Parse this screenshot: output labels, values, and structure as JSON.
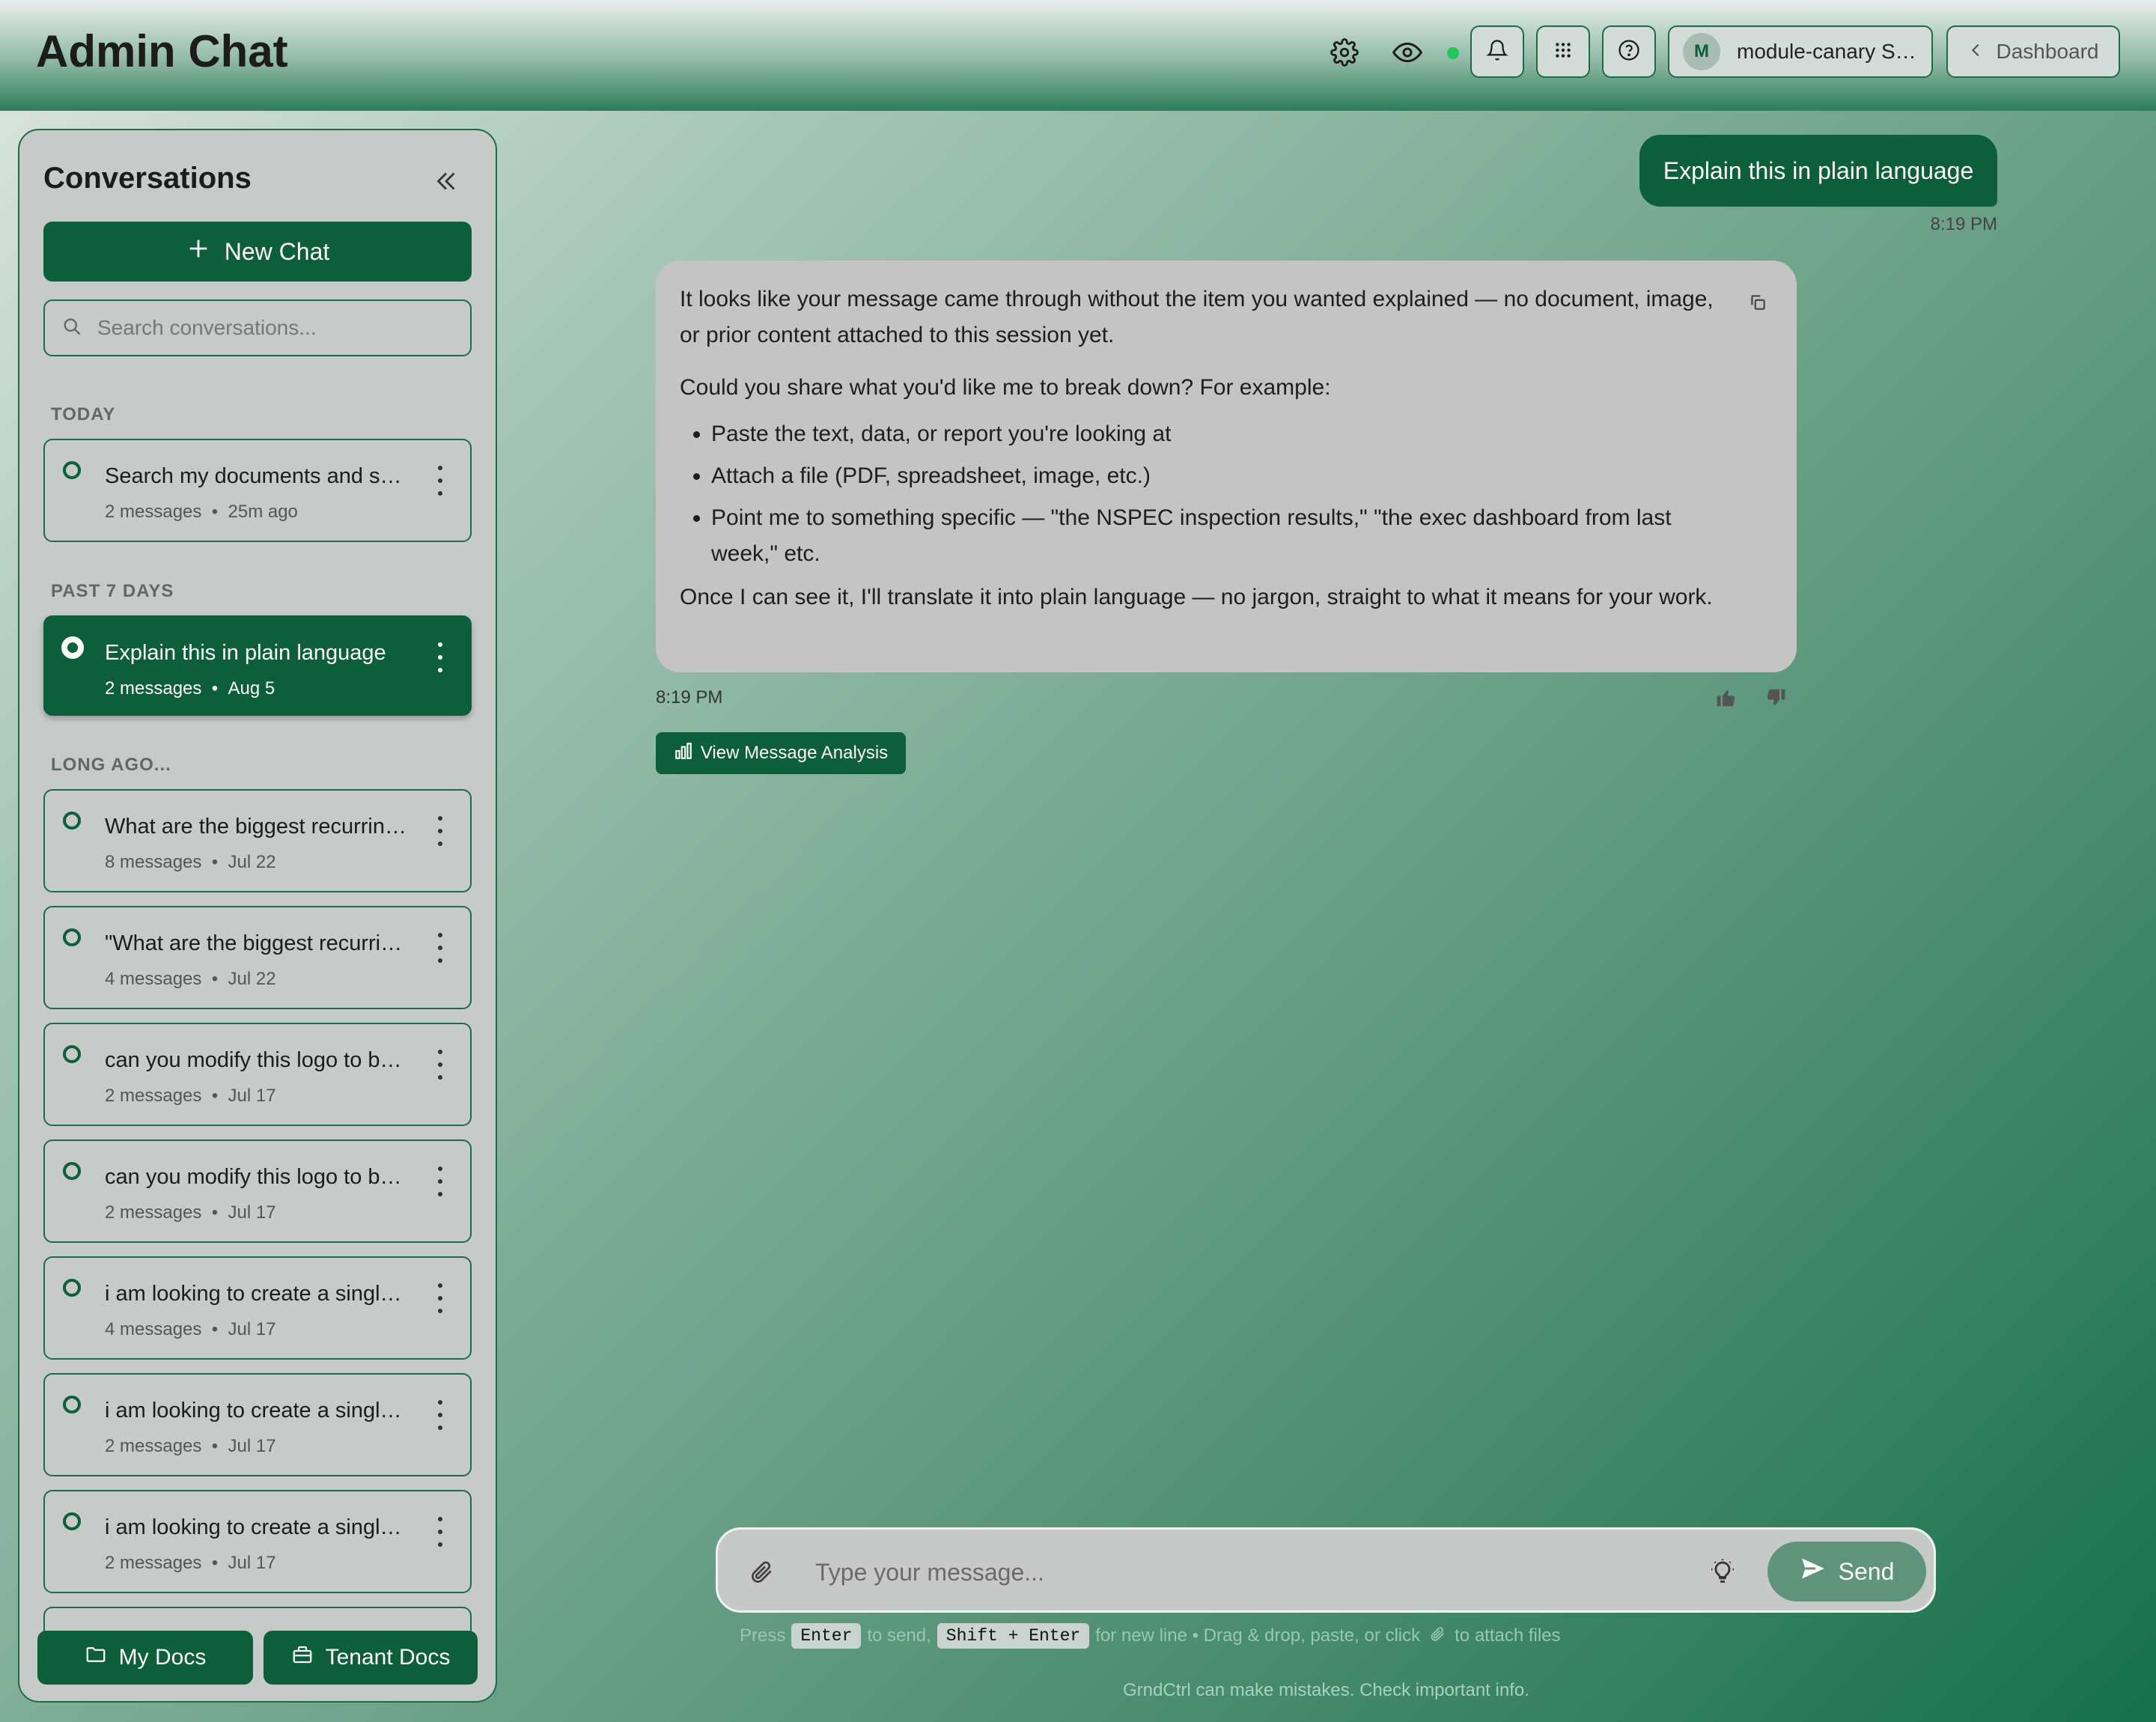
{
  "header": {
    "title": "Admin Chat",
    "user_initial": "M",
    "user_name": "module-canary S…",
    "dashboard_label": "Dashboard"
  },
  "sidebar": {
    "title": "Conversations",
    "new_chat_label": "New Chat",
    "search_placeholder": "Search conversations...",
    "groups": {
      "today": "TODAY",
      "past7": "PAST 7 DAYS",
      "long_ago": "LONG AGO..."
    },
    "conversations": [
      {
        "title": "Search my documents and su…",
        "count": "2 messages",
        "dot": "•",
        "time": "25m ago"
      },
      {
        "title": "Explain this in plain language",
        "count": "2 messages",
        "dot": "•",
        "time": "Aug 5"
      },
      {
        "title": "What are the biggest recurrin…",
        "count": "8 messages",
        "dot": "•",
        "time": "Jul 22"
      },
      {
        "title": "\"What are the biggest recurrin…",
        "count": "4 messages",
        "dot": "•",
        "time": "Jul 22"
      },
      {
        "title": "can you modify this logo to be…",
        "count": "2 messages",
        "dot": "•",
        "time": "Jul 17"
      },
      {
        "title": "can you modify this logo to be…",
        "count": "2 messages",
        "dot": "•",
        "time": "Jul 17"
      },
      {
        "title": "i am looking to create a single…",
        "count": "4 messages",
        "dot": "•",
        "time": "Jul 17"
      },
      {
        "title": "i am looking to create a single…",
        "count": "2 messages",
        "dot": "•",
        "time": "Jul 17"
      },
      {
        "title": "i am looking to create a single…",
        "count": "2 messages",
        "dot": "•",
        "time": "Jul 17"
      }
    ],
    "my_docs_label": "My Docs",
    "tenant_docs_label": "Tenant Docs"
  },
  "chat": {
    "user_message": "Explain this in plain language",
    "user_time": "8:19 PM",
    "bot_paragraph_1": "It looks like your message came through without the item you wanted explained — no document, image, or prior content attached to this session yet.",
    "bot_paragraph_2": "Could you share what you'd like me to break down? For example:",
    "bot_bullets": [
      "Paste the text, data, or report you're looking at",
      "Attach a file (PDF, spreadsheet, image, etc.)",
      "Point me to something specific — \"the NSPEC inspection results,\" \"the exec dashboard from last week,\" etc."
    ],
    "bot_paragraph_3": "Once I can see it, I'll translate it into plain language — no jargon, straight to what it means for your work.",
    "bot_time": "8:19 PM",
    "analysis_label": "View Message Analysis"
  },
  "composer": {
    "placeholder": "Type your message...",
    "send_label": "Send",
    "hint_press": "Press",
    "hint_enter_key": "Enter",
    "hint_to_send": "to send,",
    "hint_shift_key": "Shift + Enter",
    "hint_newline": "for new line • Drag & drop, paste, or click",
    "hint_attach": "to attach files",
    "disclaimer": "GrndCtrl can make mistakes. Check important info."
  },
  "icons": {
    "settings": "gear-icon",
    "visibility": "eye-icon",
    "notifications": "bell-icon",
    "apps": "grid-icon",
    "help": "help-circle-icon",
    "collapse": "double-chevron-left-icon",
    "copy": "copy-icon",
    "attach": "paperclip-icon",
    "suggest": "lightbulb-icon",
    "send": "send-icon"
  },
  "colors": {
    "brand": "#0d5e3b",
    "status_online": "#22c55e",
    "bubble_bot": "#c4c4c4"
  }
}
